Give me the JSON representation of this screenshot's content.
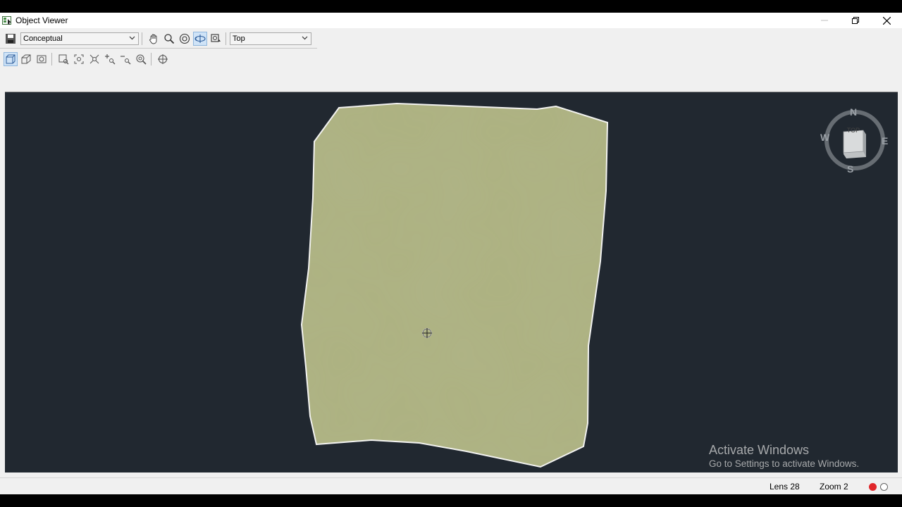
{
  "window": {
    "title": "Object Viewer"
  },
  "toolbar": {
    "visual_style": "Conceptual",
    "view": "Top"
  },
  "viewcube": {
    "face": "TOP",
    "north": "N",
    "south": "S",
    "east": "E",
    "west": "W"
  },
  "watermark": {
    "title": "Activate Windows",
    "subtitle": "Go to Settings to activate Windows."
  },
  "status": {
    "lens": "Lens 28",
    "zoom": "Zoom 2"
  },
  "colors": {
    "viewport_bg": "#212830",
    "shape_fill": "#adb281",
    "status_red": "#e0262a"
  }
}
